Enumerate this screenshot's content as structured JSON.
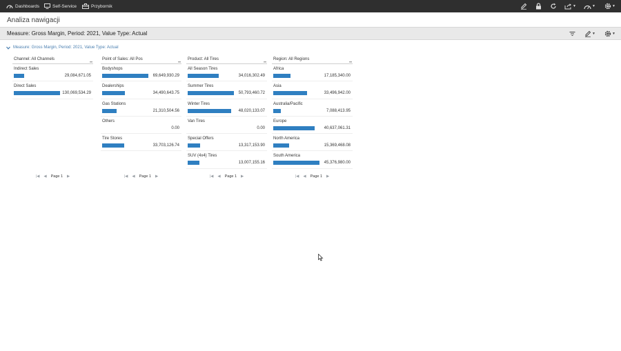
{
  "topbar": {
    "nav": [
      {
        "label": "Dashboards",
        "icon": "gauge-icon"
      },
      {
        "label": "Self-Service",
        "icon": "monitor-icon"
      },
      {
        "label": "Przybornik",
        "icon": "toolbox-icon"
      }
    ],
    "icons": [
      "edit-icon",
      "lock-icon",
      "refresh-icon",
      "share-icon",
      "gauge-icon",
      "gear-icon"
    ]
  },
  "page": {
    "title": "Analiza nawigacji"
  },
  "measure_bar": {
    "text": "Measure: Gross Margin, Period: 2021, Value Type: Actual",
    "icons": [
      "filter-icon",
      "edit-icon",
      "gear-icon"
    ]
  },
  "breadcrumb": {
    "text": "Measure: Gross Margin, Period: 2021, Value Type: Actual"
  },
  "colors": {
    "bar": "#2f7fc1",
    "topbar": "#2f2f2f",
    "link": "#4a7fb0"
  },
  "panels": [
    {
      "header": "Channel: All Channels",
      "rows": [
        {
          "label": "Indirect Sales",
          "value": "29,084,671.05",
          "fraction": 0.223
        },
        {
          "label": "Direct Sales",
          "value": "130,069,534.29",
          "fraction": 1.0
        }
      ],
      "pager": "Page 1"
    },
    {
      "header": "Point of Sales: All Pos",
      "rows": [
        {
          "label": "Bodyshops",
          "value": "69,649,930.29",
          "fraction": 1.0
        },
        {
          "label": "Dealerships",
          "value": "34,490,643.75",
          "fraction": 0.495
        },
        {
          "label": "Gas Stations",
          "value": "21,310,504.56",
          "fraction": 0.306
        },
        {
          "label": "Others",
          "value": "0.00",
          "fraction": 0
        },
        {
          "label": "Tire Stores",
          "value": "33,703,126.74",
          "fraction": 0.484
        }
      ],
      "pager": "Page 1"
    },
    {
      "header": "Product: All Tires",
      "rows": [
        {
          "label": "All Season Tires",
          "value": "34,016,302.49",
          "fraction": 0.67
        },
        {
          "label": "Summer Tires",
          "value": "50,793,460.72",
          "fraction": 1.0
        },
        {
          "label": "Winter Tires",
          "value": "48,020,133.07",
          "fraction": 0.945
        },
        {
          "label": "Van Tires",
          "value": "0.00",
          "fraction": 0
        },
        {
          "label": "Special Offers",
          "value": "13,317,153.90",
          "fraction": 0.262
        },
        {
          "label": "SUV (4x4) Tires",
          "value": "13,007,155.16",
          "fraction": 0.256
        }
      ],
      "pager": "Page 1"
    },
    {
      "header": "Region: All Regions",
      "rows": [
        {
          "label": "Africa",
          "value": "17,185,340.00",
          "fraction": 0.379
        },
        {
          "label": "Asia",
          "value": "33,496,942.00",
          "fraction": 0.738
        },
        {
          "label": "Australia/Pacific",
          "value": "7,088,413.95",
          "fraction": 0.156
        },
        {
          "label": "Europe",
          "value": "40,637,061.31",
          "fraction": 0.896
        },
        {
          "label": "North America",
          "value": "15,369,468.08",
          "fraction": 0.339
        },
        {
          "label": "South America",
          "value": "45,376,980.00",
          "fraction": 1.0
        }
      ],
      "pager": "Page 1"
    }
  ]
}
